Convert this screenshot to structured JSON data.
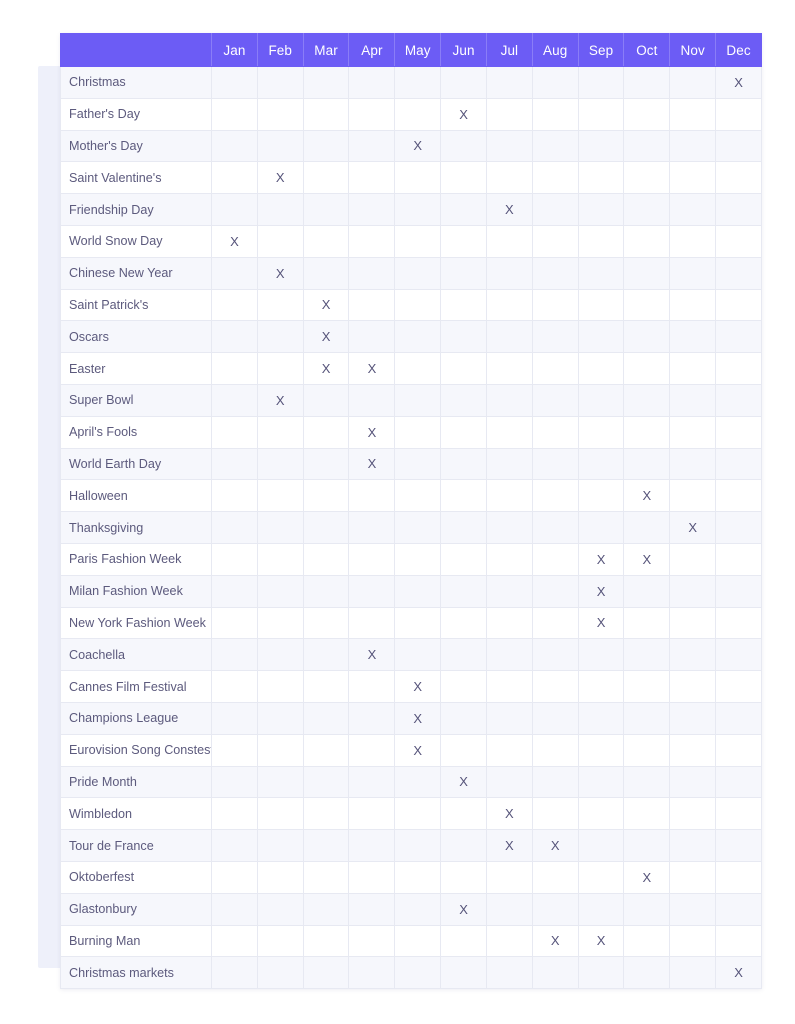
{
  "chart_data": {
    "type": "heatmap",
    "title": "",
    "xlabel": "",
    "ylabel": "",
    "legend": "",
    "grid": true,
    "mark_symbol": "X",
    "accent_color": "#6c5cf5",
    "row_stripe_color": "#f6f7fc",
    "text_color": "#5c5a7d",
    "corner_header": "",
    "categories": [
      "Jan",
      "Feb",
      "Mar",
      "Apr",
      "May",
      "Jun",
      "Jul",
      "Aug",
      "Sep",
      "Oct",
      "Nov",
      "Dec"
    ],
    "rows": [
      {
        "label": "Christmas",
        "values": [
          0,
          0,
          0,
          0,
          0,
          0,
          0,
          0,
          0,
          0,
          0,
          1
        ]
      },
      {
        "label": "Father's Day",
        "values": [
          0,
          0,
          0,
          0,
          0,
          1,
          0,
          0,
          0,
          0,
          0,
          0
        ]
      },
      {
        "label": "Mother's Day",
        "values": [
          0,
          0,
          0,
          0,
          1,
          0,
          0,
          0,
          0,
          0,
          0,
          0
        ]
      },
      {
        "label": "Saint Valentine's",
        "values": [
          0,
          1,
          0,
          0,
          0,
          0,
          0,
          0,
          0,
          0,
          0,
          0
        ]
      },
      {
        "label": "Friendship Day",
        "values": [
          0,
          0,
          0,
          0,
          0,
          0,
          1,
          0,
          0,
          0,
          0,
          0
        ]
      },
      {
        "label": "World Snow Day",
        "values": [
          1,
          0,
          0,
          0,
          0,
          0,
          0,
          0,
          0,
          0,
          0,
          0
        ]
      },
      {
        "label": "Chinese New Year",
        "values": [
          0,
          1,
          0,
          0,
          0,
          0,
          0,
          0,
          0,
          0,
          0,
          0
        ]
      },
      {
        "label": "Saint Patrick's",
        "values": [
          0,
          0,
          1,
          0,
          0,
          0,
          0,
          0,
          0,
          0,
          0,
          0
        ]
      },
      {
        "label": "Oscars",
        "values": [
          0,
          0,
          1,
          0,
          0,
          0,
          0,
          0,
          0,
          0,
          0,
          0
        ]
      },
      {
        "label": "Easter",
        "values": [
          0,
          0,
          1,
          1,
          0,
          0,
          0,
          0,
          0,
          0,
          0,
          0
        ]
      },
      {
        "label": "Super Bowl",
        "values": [
          0,
          1,
          0,
          0,
          0,
          0,
          0,
          0,
          0,
          0,
          0,
          0
        ]
      },
      {
        "label": "April's Fools",
        "values": [
          0,
          0,
          0,
          1,
          0,
          0,
          0,
          0,
          0,
          0,
          0,
          0
        ]
      },
      {
        "label": "World Earth Day",
        "values": [
          0,
          0,
          0,
          1,
          0,
          0,
          0,
          0,
          0,
          0,
          0,
          0
        ]
      },
      {
        "label": "Halloween",
        "values": [
          0,
          0,
          0,
          0,
          0,
          0,
          0,
          0,
          0,
          1,
          0,
          0
        ]
      },
      {
        "label": "Thanksgiving",
        "values": [
          0,
          0,
          0,
          0,
          0,
          0,
          0,
          0,
          0,
          0,
          1,
          0
        ]
      },
      {
        "label": "Paris Fashion Week",
        "values": [
          0,
          0,
          0,
          0,
          0,
          0,
          0,
          0,
          1,
          1,
          0,
          0
        ]
      },
      {
        "label": "Milan Fashion Week",
        "values": [
          0,
          0,
          0,
          0,
          0,
          0,
          0,
          0,
          1,
          0,
          0,
          0
        ]
      },
      {
        "label": "New York Fashion Week",
        "values": [
          0,
          0,
          0,
          0,
          0,
          0,
          0,
          0,
          1,
          0,
          0,
          0
        ]
      },
      {
        "label": "Coachella",
        "values": [
          0,
          0,
          0,
          1,
          0,
          0,
          0,
          0,
          0,
          0,
          0,
          0
        ]
      },
      {
        "label": "Cannes Film Festival",
        "values": [
          0,
          0,
          0,
          0,
          1,
          0,
          0,
          0,
          0,
          0,
          0,
          0
        ]
      },
      {
        "label": "Champions League",
        "values": [
          0,
          0,
          0,
          0,
          1,
          0,
          0,
          0,
          0,
          0,
          0,
          0
        ]
      },
      {
        "label": "Eurovision Song Constest",
        "values": [
          0,
          0,
          0,
          0,
          1,
          0,
          0,
          0,
          0,
          0,
          0,
          0
        ]
      },
      {
        "label": "Pride Month",
        "values": [
          0,
          0,
          0,
          0,
          0,
          1,
          0,
          0,
          0,
          0,
          0,
          0
        ]
      },
      {
        "label": "Wimbledon",
        "values": [
          0,
          0,
          0,
          0,
          0,
          0,
          1,
          0,
          0,
          0,
          0,
          0
        ]
      },
      {
        "label": "Tour de France",
        "values": [
          0,
          0,
          0,
          0,
          0,
          0,
          1,
          1,
          0,
          0,
          0,
          0
        ]
      },
      {
        "label": "Oktoberfest",
        "values": [
          0,
          0,
          0,
          0,
          0,
          0,
          0,
          0,
          0,
          1,
          0,
          0
        ]
      },
      {
        "label": "Glastonbury",
        "values": [
          0,
          0,
          0,
          0,
          0,
          1,
          0,
          0,
          0,
          0,
          0,
          0
        ]
      },
      {
        "label": "Burning Man",
        "values": [
          0,
          0,
          0,
          0,
          0,
          0,
          0,
          1,
          1,
          0,
          0,
          0
        ]
      },
      {
        "label": "Christmas markets",
        "values": [
          0,
          0,
          0,
          0,
          0,
          0,
          0,
          0,
          0,
          0,
          0,
          1
        ]
      }
    ]
  }
}
